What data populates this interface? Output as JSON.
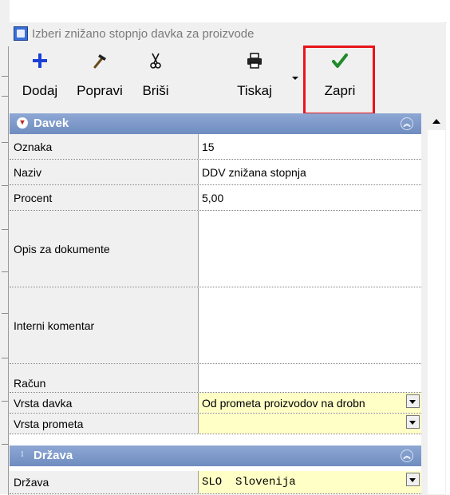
{
  "window": {
    "title": "Izberi znižano stopnjo davka za proizvode"
  },
  "toolbar": {
    "add": {
      "label": "Dodaj",
      "icon": "plus-icon"
    },
    "edit": {
      "label": "Popravi",
      "icon": "hammer-icon"
    },
    "delete": {
      "label": "Briši",
      "icon": "scissors-icon"
    },
    "print": {
      "label": "Tiskaj",
      "icon": "printer-icon"
    },
    "close": {
      "label": "Zapri",
      "icon": "checkmark-icon"
    }
  },
  "sections": {
    "davek": {
      "title": "Davek",
      "rows": {
        "oznaka": {
          "label": "Oznaka",
          "value": "15"
        },
        "naziv": {
          "label": "Naziv",
          "value": "DDV znižana stopnja"
        },
        "procent": {
          "label": "Procent",
          "value": "5,00"
        },
        "opis": {
          "label": "Opis za dokumente",
          "value": ""
        },
        "komentar": {
          "label": "Interni komentar",
          "value": ""
        },
        "racun": {
          "label": "Račun",
          "value": ""
        },
        "vrsta_davka": {
          "label": "Vrsta davka",
          "value": "Od prometa proizvodov na drobn"
        },
        "vrsta_prometa": {
          "label": "Vrsta prometa",
          "value": ""
        }
      }
    },
    "drzava": {
      "title": "Država",
      "rows": {
        "drzava": {
          "label": "Država",
          "value": "SLO  Slovenija"
        }
      }
    }
  },
  "colors": {
    "section_header": "#7b96c8",
    "highlight": "#e8141a",
    "yellow_field": "#ffffc6",
    "check": "#1f8a2a",
    "plus": "#1a3fd6"
  }
}
